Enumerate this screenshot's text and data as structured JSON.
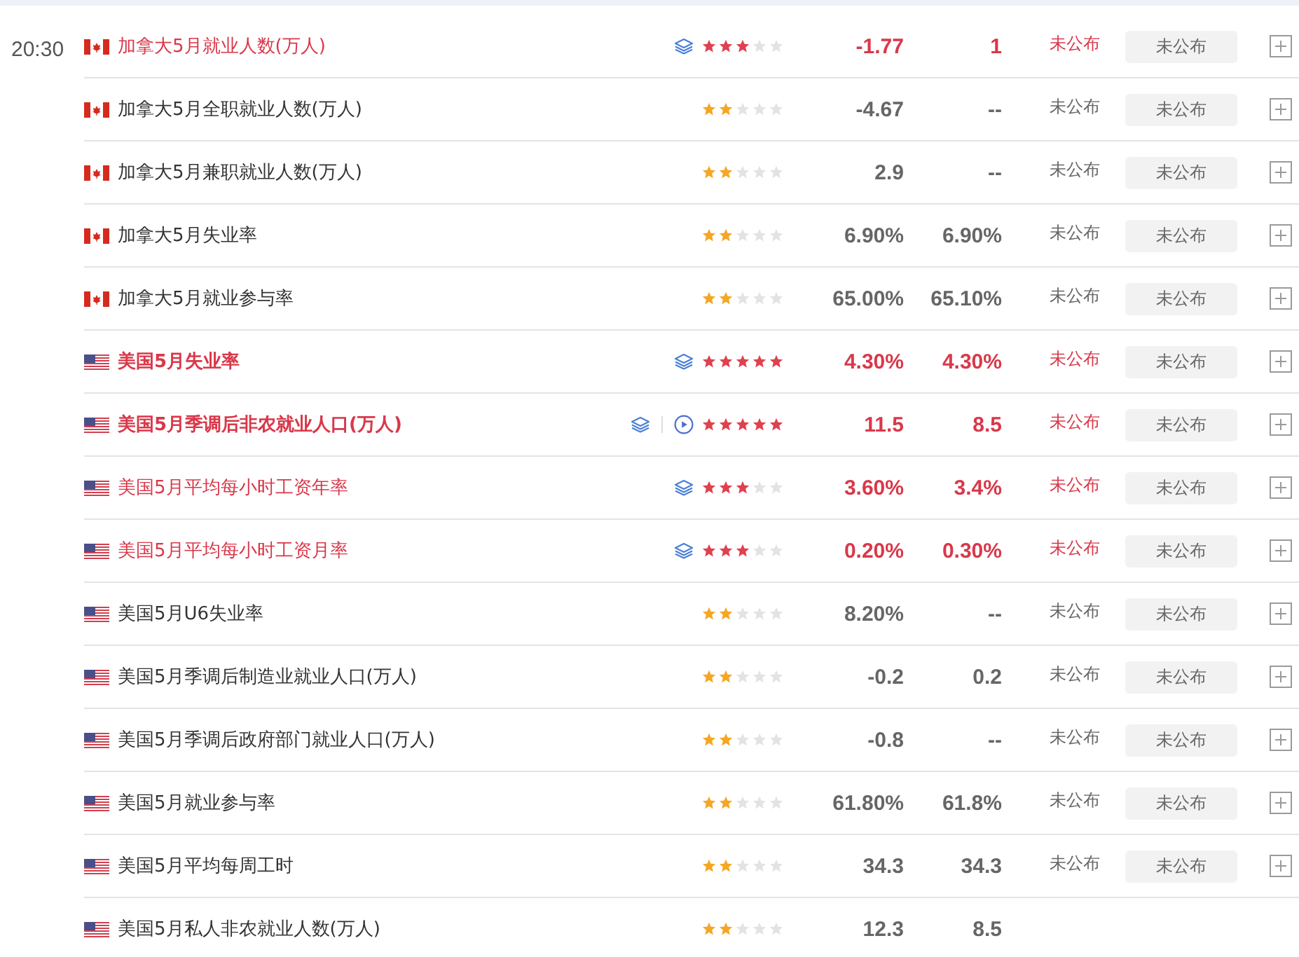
{
  "groups": [
    {
      "time": "20:30",
      "rows": [
        {
          "flag": {
            "kind": "canada"
          },
          "name": "加拿大5月就业人数(万人)",
          "important": true,
          "bold": false,
          "extras": [
            {
              "kind": "layers"
            }
          ],
          "stars": 3,
          "actual": "-1.77",
          "forecast": "1",
          "status": "未公布",
          "button": "未公布"
        },
        {
          "flag": {
            "kind": "canada"
          },
          "name": "加拿大5月全职就业人数(万人)",
          "important": false,
          "bold": false,
          "extras": [],
          "stars": 2,
          "actual": "-4.67",
          "forecast": "--",
          "status": "未公布",
          "button": "未公布"
        },
        {
          "flag": {
            "kind": "canada"
          },
          "name": "加拿大5月兼职就业人数(万人)",
          "important": false,
          "bold": false,
          "extras": [],
          "stars": 2,
          "actual": "2.9",
          "forecast": "--",
          "status": "未公布",
          "button": "未公布"
        },
        {
          "flag": {
            "kind": "canada"
          },
          "name": "加拿大5月失业率",
          "important": false,
          "bold": false,
          "extras": [],
          "stars": 2,
          "actual": "6.90%",
          "forecast": "6.90%",
          "status": "未公布",
          "button": "未公布"
        },
        {
          "flag": {
            "kind": "canada"
          },
          "name": "加拿大5月就业参与率",
          "important": false,
          "bold": false,
          "extras": [],
          "stars": 2,
          "actual": "65.00%",
          "forecast": "65.10%",
          "status": "未公布",
          "button": "未公布"
        },
        {
          "flag": {
            "kind": "usa"
          },
          "name": "美国5月失业率",
          "important": true,
          "bold": true,
          "extras": [
            {
              "kind": "layers"
            }
          ],
          "stars": 5,
          "actual": "4.30%",
          "forecast": "4.30%",
          "status": "未公布",
          "button": "未公布"
        },
        {
          "flag": {
            "kind": "usa"
          },
          "name": "美国5月季调后非农就业人口(万人)",
          "important": true,
          "bold": true,
          "extras": [
            {
              "kind": "layers"
            },
            {
              "kind": "video"
            }
          ],
          "stars": 5,
          "actual": "11.5",
          "forecast": "8.5",
          "status": "未公布",
          "button": "未公布"
        },
        {
          "flag": {
            "kind": "usa"
          },
          "name": "美国5月平均每小时工资年率",
          "important": true,
          "bold": false,
          "extras": [
            {
              "kind": "layers"
            }
          ],
          "stars": 3,
          "actual": "3.60%",
          "forecast": "3.4%",
          "status": "未公布",
          "button": "未公布"
        },
        {
          "flag": {
            "kind": "usa"
          },
          "name": "美国5月平均每小时工资月率",
          "important": true,
          "bold": false,
          "extras": [
            {
              "kind": "layers"
            }
          ],
          "stars": 3,
          "actual": "0.20%",
          "forecast": "0.30%",
          "status": "未公布",
          "button": "未公布"
        },
        {
          "flag": {
            "kind": "usa"
          },
          "name": "美国5月U6失业率",
          "important": false,
          "bold": false,
          "extras": [],
          "stars": 2,
          "actual": "8.20%",
          "forecast": "--",
          "status": "未公布",
          "button": "未公布"
        },
        {
          "flag": {
            "kind": "usa"
          },
          "name": "美国5月季调后制造业就业人口(万人)",
          "important": false,
          "bold": false,
          "extras": [],
          "stars": 2,
          "actual": "-0.2",
          "forecast": "0.2",
          "status": "未公布",
          "button": "未公布"
        },
        {
          "flag": {
            "kind": "usa"
          },
          "name": "美国5月季调后政府部门就业人口(万人)",
          "important": false,
          "bold": false,
          "extras": [],
          "stars": 2,
          "actual": "-0.8",
          "forecast": "--",
          "status": "未公布",
          "button": "未公布"
        },
        {
          "flag": {
            "kind": "usa"
          },
          "name": "美国5月就业参与率",
          "important": false,
          "bold": false,
          "extras": [],
          "stars": 2,
          "actual": "61.80%",
          "forecast": "61.8%",
          "status": "未公布",
          "button": "未公布"
        },
        {
          "flag": {
            "kind": "usa"
          },
          "name": "美国5月平均每周工时",
          "important": false,
          "bold": false,
          "extras": [],
          "stars": 2,
          "actual": "34.3",
          "forecast": "34.3",
          "status": "未公布",
          "button": "未公布"
        },
        {
          "flag": {
            "kind": "usa"
          },
          "name": "美国5月私人非农就业人数(万人)",
          "important": false,
          "bold": false,
          "extras": [],
          "stars": 2,
          "actual": "12.3",
          "forecast": "8.5"
        }
      ]
    }
  ]
}
